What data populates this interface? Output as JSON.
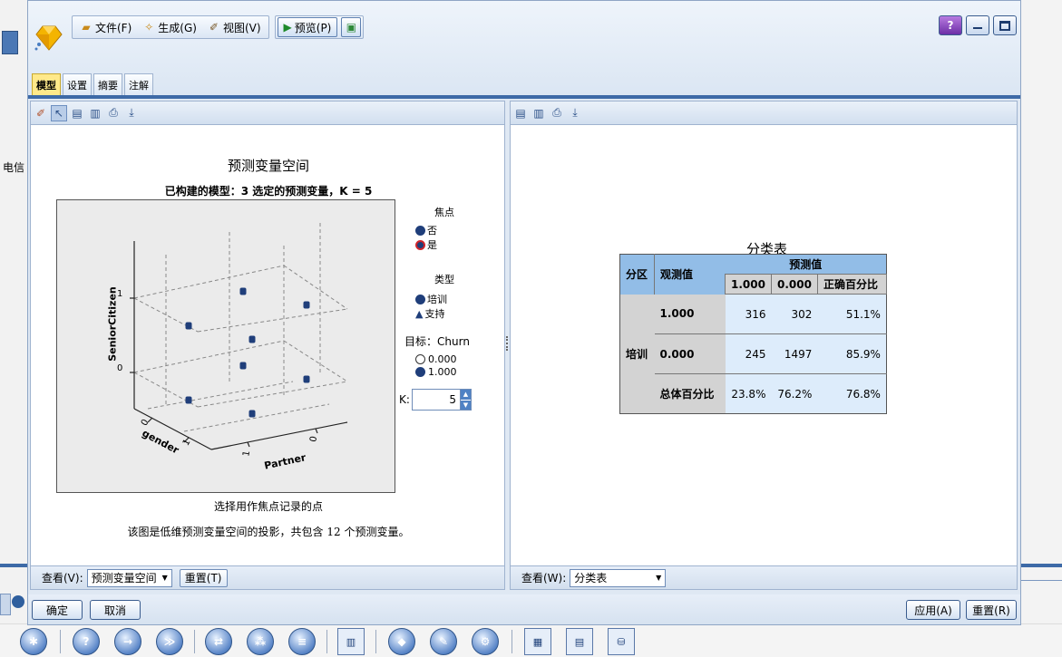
{
  "menu": {
    "file": "文件(F)",
    "generate": "生成(G)",
    "view": "视图(V)",
    "preview": "预览(P)"
  },
  "tabs": [
    "模型",
    "设置",
    "摘要",
    "注解"
  ],
  "background": {
    "side_label": "电信"
  },
  "left_pane": {
    "chart": {
      "title": "预测变量空间",
      "subtitle": "已构建的模型：3 选定的预测变量，K = 5",
      "caption1": "选择用作焦点记录的点",
      "caption2": "该图是低维预测变量空间的投影，共包含 12 个预测变量。",
      "axis_z_label": "SeniorCitizen",
      "axis_x_label": "gender",
      "axis_y_label": "Partner",
      "z_ticks": [
        "1",
        "0"
      ],
      "gender_ticks": [
        "0",
        "1"
      ],
      "partner_ticks": [
        "1",
        "0"
      ]
    },
    "legend": {
      "focus_title": "焦点",
      "focus_no": "否",
      "focus_yes": "是",
      "type_title": "类型",
      "type_train": "培训",
      "type_support": "支持",
      "target_title": "目标：Churn",
      "target_0": "0.000",
      "target_1": "1.000",
      "k_label": "K:",
      "k_value": "5"
    },
    "footer": {
      "view_label": "查看(V):",
      "view_value": "预测变量空间",
      "reset": "重置(T)"
    }
  },
  "right_pane": {
    "table_title": "分类表",
    "header": {
      "partition": "分区",
      "observed": "观测值",
      "predicted": "预测值",
      "col1": "1.000",
      "col2": "0.000",
      "col3": "正确百分比"
    },
    "partition_label": "培训",
    "rows": [
      {
        "label": "1.000",
        "v1": "316",
        "v2": "302",
        "v3": "51.1%"
      },
      {
        "label": "0.000",
        "v1": "245",
        "v2": "1497",
        "v3": "85.9%"
      },
      {
        "label": "总体百分比",
        "v1": "23.8%",
        "v2": "76.2%",
        "v3": "76.8%"
      }
    ],
    "footer": {
      "view_label": "查看(W):",
      "view_value": "分类表"
    }
  },
  "buttons": {
    "ok": "确定",
    "cancel": "取消",
    "apply": "应用(A)",
    "reset": "重置(R)"
  },
  "chart_data": {
    "type": "scatter",
    "title": "预测变量空间",
    "subtitle": "已构建的模型：3 选定的预测变量，K = 5",
    "axes": {
      "x": "gender",
      "y": "Partner",
      "z": "SeniorCitizen"
    },
    "points": [
      {
        "gender": 0,
        "partner": 1,
        "senior": 1
      },
      {
        "gender": 1,
        "partner": 1,
        "senior": 1
      },
      {
        "gender": 0,
        "partner": 0,
        "senior": 1
      },
      {
        "gender": 1,
        "partner": 0,
        "senior": 1
      },
      {
        "gender": 0,
        "partner": 1,
        "senior": 0
      },
      {
        "gender": 1,
        "partner": 1,
        "senior": 0
      },
      {
        "gender": 0,
        "partner": 0,
        "senior": 0
      },
      {
        "gender": 1,
        "partner": 0,
        "senior": 0
      }
    ]
  },
  "colors": {
    "accent": "#3d6aa7",
    "point": "#1f3e7a",
    "table_header": "#92bde7",
    "table_cell": "#ddecfb"
  }
}
